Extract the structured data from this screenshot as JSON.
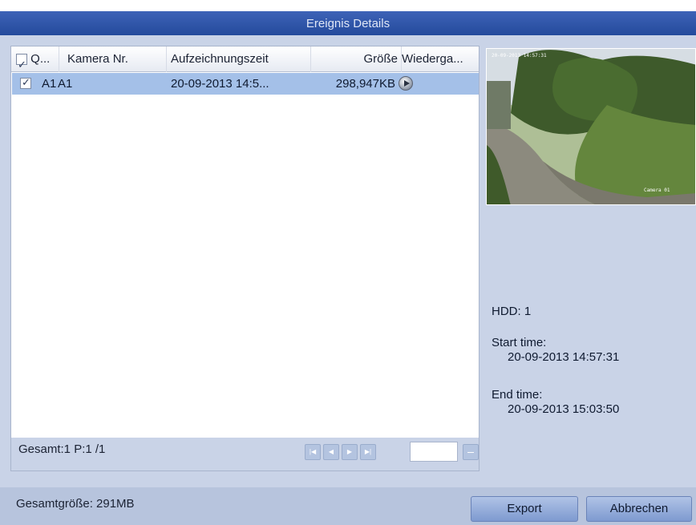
{
  "window": {
    "title": "Ereignis Details"
  },
  "table": {
    "headers": [
      "Q...",
      "Kamera Nr.",
      "Aufzeichnungszeit",
      "Größe",
      "Wiederga..."
    ],
    "rows": [
      {
        "col1": "A1",
        "camera": "A1",
        "time": "20-09-2013 14:5...",
        "size": "298,947KB",
        "checked": true
      }
    ]
  },
  "pager": {
    "text": "Gesamt:1 P:1 /1"
  },
  "preview": {
    "osd_date": "20-09-2013 14:57:31",
    "osd_cam": "Camera 01",
    "colors": {
      "grass": "#5f7d3c",
      "tree": "#3d5a2a",
      "sky": "#d8dfe7",
      "path": "#8c8a7e"
    }
  },
  "info": {
    "hdd": "HDD: 1",
    "start_label": "Start time:",
    "start_value": "20-09-2013 14:57:31",
    "end_label": "End time:",
    "end_value": "20-09-2013 15:03:50"
  },
  "footer": {
    "total": "Gesamtgröße: 291MB",
    "export": "Export",
    "cancel": "Abbrechen"
  },
  "icons": [
    "checkbox-icon",
    "play-icon",
    "first-page-icon",
    "prev-page-icon",
    "next-page-icon",
    "last-page-icon",
    "go-icon"
  ]
}
